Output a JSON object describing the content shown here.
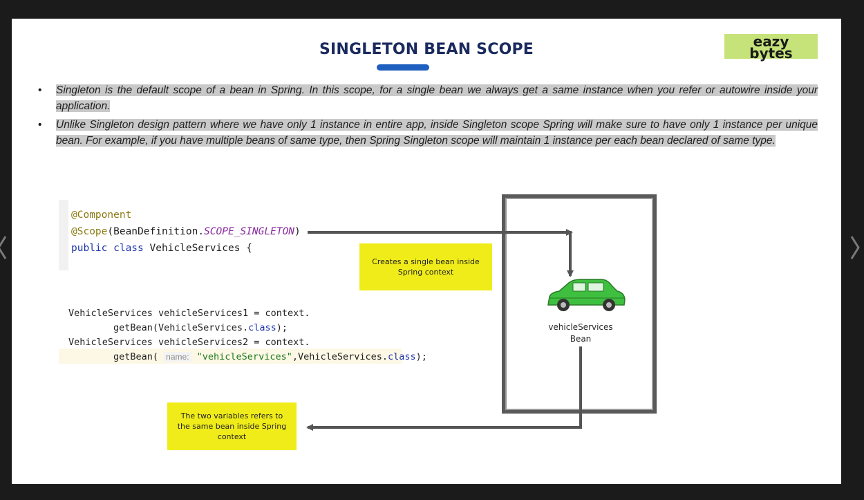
{
  "slide": {
    "title": "SINGLETON BEAN SCOPE",
    "logo_line1": "eazy",
    "logo_line2": "bytes",
    "bullets": [
      "Singleton is the default scope of a bean in Spring. In this scope, for a single bean we always get a same instance when you refer or autowire inside your application.",
      "Unlike Singleton design pattern where we have only 1 instance in entire app, inside Singleton scope Spring will make sure to have only 1 instance per unique bean. For example, if you have multiple beans of same type, then Spring Singleton scope will maintain 1 instance per each bean declared of same type."
    ],
    "bullet_glyph": "•"
  },
  "code1": {
    "line1": "@Component",
    "line2_annotation": "@Scope",
    "line2_open": "(BeanDefinition.",
    "line2_const": "SCOPE_SINGLETON",
    "line2_close": ")",
    "line3_kw": "public class",
    "line3_rest": " VehicleServices {"
  },
  "code2": {
    "line1": "VehicleServices vehicleServices1 = context.",
    "line2_pre": "        getBean(VehicleServices.",
    "line2_kw": "class",
    "line2_post": ");",
    "line3": "VehicleServices vehicleServices2 = context.",
    "line4_pre": "        getBean( ",
    "line4_hint": "name:",
    "line4_str": " \"vehicleServices\"",
    "line4_mid": ",VehicleServices.",
    "line4_kw": "class",
    "line4_post": ");"
  },
  "diagram": {
    "bean_label_line1": "vehicleServices",
    "bean_label_line2": "Bean",
    "note1": "Creates a single bean inside Spring context",
    "note2": "The two variables refers to the same bean inside Spring context",
    "car_icon": "car-icon",
    "colors": {
      "car": "#3fbf3f",
      "note": "#f0ec1a",
      "arrow": "#555555"
    }
  },
  "navigation": {
    "prev_icon": "chevron-left-icon",
    "next_icon": "chevron-right-icon"
  }
}
